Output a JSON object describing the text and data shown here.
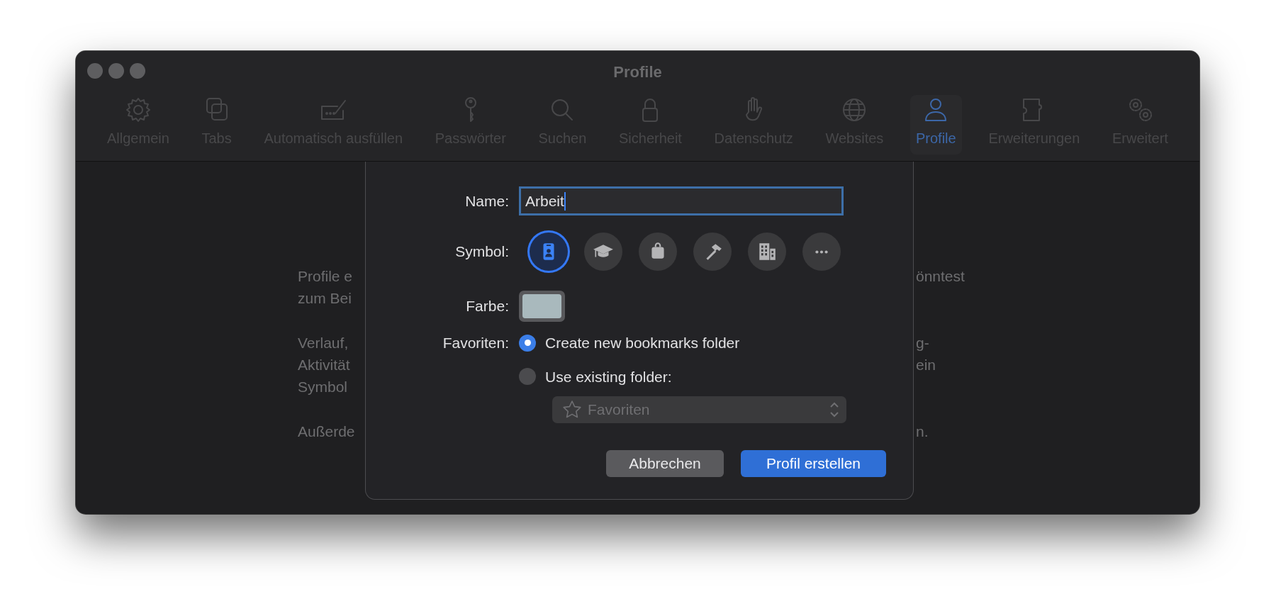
{
  "window": {
    "title": "Profile"
  },
  "toolbar": [
    {
      "label": "Allgemein",
      "selected": false
    },
    {
      "label": "Tabs",
      "selected": false
    },
    {
      "label": "Automatisch ausfüllen",
      "selected": false
    },
    {
      "label": "Passwörter",
      "selected": false
    },
    {
      "label": "Suchen",
      "selected": false
    },
    {
      "label": "Sicherheit",
      "selected": false
    },
    {
      "label": "Datenschutz",
      "selected": false
    },
    {
      "label": "Websites",
      "selected": false
    },
    {
      "label": "Profile",
      "selected": true
    },
    {
      "label": "Erweiterungen",
      "selected": false
    },
    {
      "label": "Erweitert",
      "selected": false
    }
  ],
  "background_text": [
    [
      {
        "left": "Profile e",
        "right": "önntest"
      },
      {
        "left": "zum Bei"
      }
    ],
    [
      {
        "left": "Verlauf,",
        "right": "g-"
      },
      {
        "left": "Aktivität",
        "right": "ein"
      },
      {
        "left": "Symbol"
      }
    ],
    [
      {
        "left": "Außerde",
        "right": "n."
      }
    ]
  ],
  "dialog": {
    "name": {
      "label": "Name:",
      "value": "Arbeit",
      "focused": true
    },
    "symbol": {
      "label": "Symbol:",
      "options": [
        {
          "selected": true
        },
        {
          "selected": false
        },
        {
          "selected": false
        },
        {
          "selected": false
        },
        {
          "selected": false
        },
        {
          "selected": false
        }
      ]
    },
    "color": {
      "label": "Farbe:",
      "color": "#a9b9bd"
    },
    "favorites": {
      "label": "Favoriten:",
      "options": [
        {
          "label": "Create new bookmarks folder",
          "selected": true
        },
        {
          "label": "Use existing folder:",
          "selected": false
        }
      ],
      "popup": {
        "value": "Favoriten",
        "disabled": true
      }
    },
    "buttons": [
      {
        "label": "Abbrechen",
        "kind": "secondary"
      },
      {
        "label": "Profil erstellen",
        "kind": "primary"
      }
    ]
  }
}
